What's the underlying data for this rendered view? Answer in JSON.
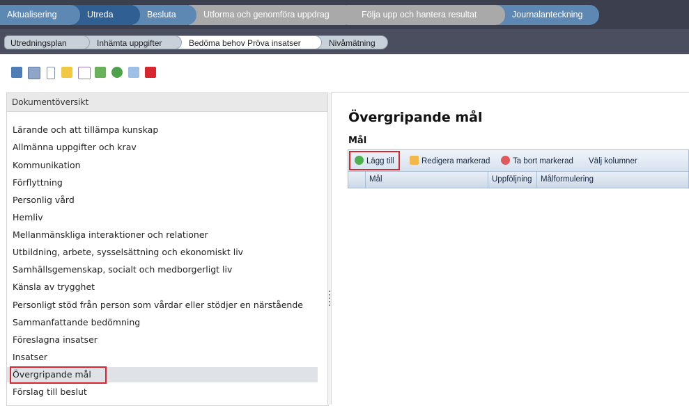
{
  "process_tabs": [
    {
      "label": "Aktualisering",
      "state": "done"
    },
    {
      "label": "Utreda",
      "state": "active"
    },
    {
      "label": "Besluta",
      "state": "done"
    },
    {
      "label": "Utforma och genomföra uppdrag",
      "state": "inactive"
    },
    {
      "label": "Följa upp och hantera resultat",
      "state": "inactive"
    },
    {
      "label": "Journalanteckning",
      "state": "done"
    }
  ],
  "sub_steps": [
    {
      "label": "Utredningsplan"
    },
    {
      "label": "Inhämta uppgifter"
    },
    {
      "label": "Bedöma behov Pröva insatser",
      "active": true
    },
    {
      "label": "Nivåmätning"
    }
  ],
  "toolbar_icons": [
    "save-icon",
    "document-check-icon",
    "document-icon",
    "folder-icon",
    "envelope-icon",
    "move-icon",
    "refresh-icon",
    "spellcheck-icon",
    "calendar-icon"
  ],
  "left_panel": {
    "title": "Dokumentöversikt",
    "items": [
      "Lärande och att tillämpa kunskap",
      "Allmänna uppgifter och krav",
      "Kommunikation",
      "Förflyttning",
      "Personlig vård",
      "Hemliv",
      "Mellanmänskliga interaktioner och relationer",
      "Utbildning, arbete, sysselsättning och ekonomiskt liv",
      "Samhällsgemenskap, socialt och medborgerligt liv",
      "Känsla av trygghet",
      "Personligt stöd från person som vårdar eller stödjer en närstående",
      "Sammanfattande bedömning",
      "Föreslagna insatser",
      "Insatser",
      "Övergripande mål",
      "Förslag till beslut"
    ],
    "selected": "Övergripande mål"
  },
  "main": {
    "title": "Övergripande mål",
    "section": "Mål",
    "actions": {
      "add": "Lägg till",
      "edit": "Redigera markerad",
      "delete": "Ta bort markerad",
      "columns": "Välj kolumner"
    },
    "columns": [
      "Mål",
      "Uppföljning",
      "Målformulering"
    ]
  },
  "colors": {
    "header_dark": "#3b3f4e",
    "tab_blue": "#5d88b4",
    "tab_grey": "#a9a9a9",
    "highlight_red": "#d9262e"
  }
}
